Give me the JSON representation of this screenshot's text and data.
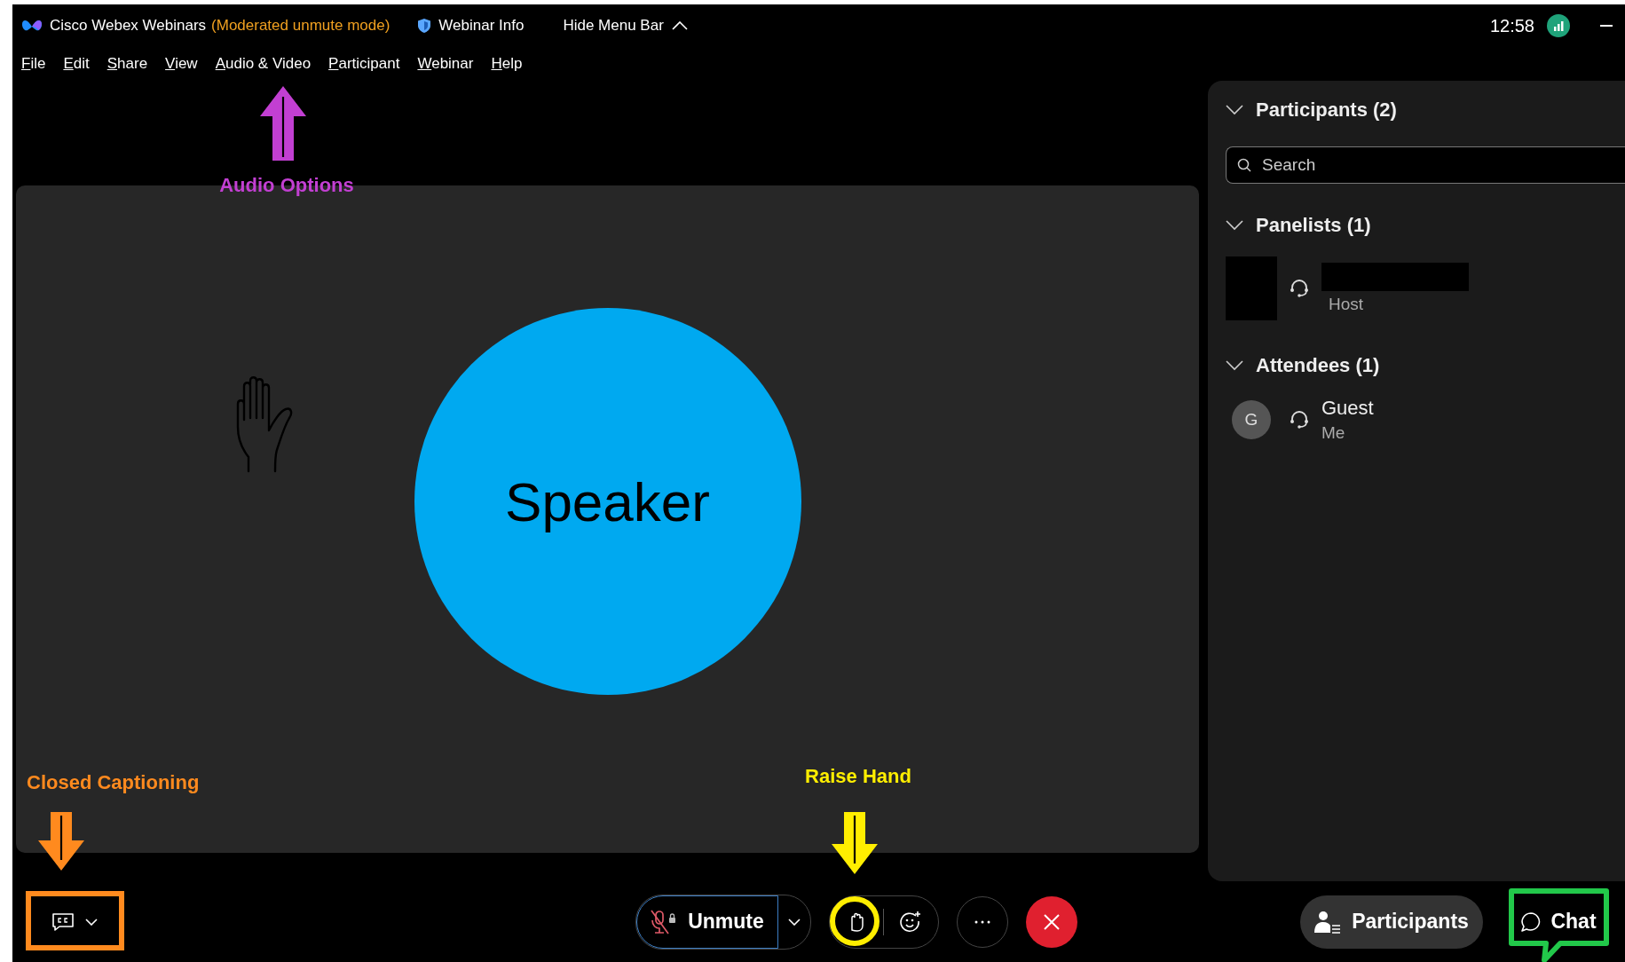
{
  "title_bar": {
    "app_name": "Cisco Webex Webinars",
    "mode": "(Moderated unmute mode)",
    "webinar_info": "Webinar Info",
    "hide_menu_bar": "Hide Menu Bar",
    "time": "12:58"
  },
  "menu": [
    "File",
    "Edit",
    "Share",
    "View",
    "Audio & Video",
    "Participant",
    "Webinar",
    "Help"
  ],
  "stage": {
    "speaker_label": "Speaker"
  },
  "participants_panel": {
    "title": "Participants (2)",
    "expanded": true,
    "search": {
      "placeholder": "Search"
    },
    "groups": [
      {
        "title": "Panelists (1)",
        "expanded": true,
        "members": [
          {
            "redacted": true,
            "role": "Host"
          }
        ]
      },
      {
        "title": "Attendees (1)",
        "expanded": true,
        "members": [
          {
            "redacted": false,
            "initial": "G",
            "name": "Guest",
            "role": "Me"
          }
        ]
      }
    ]
  },
  "controls": {
    "unmute": {
      "label": "Unmute",
      "muted": true
    },
    "participants": "Participants",
    "chat": "Chat"
  },
  "annotations": [
    {
      "kind": "label-arrow-up",
      "text": "Audio Options",
      "color": "#c23fd2"
    },
    {
      "kind": "label-arrow-down",
      "text": "Closed Captioning",
      "color": "#ff8a1e"
    },
    {
      "kind": "label-arrow-down",
      "text": "Raise Hand",
      "color": "#ffee00"
    },
    {
      "kind": "callout",
      "color": "#22c84a"
    }
  ]
}
